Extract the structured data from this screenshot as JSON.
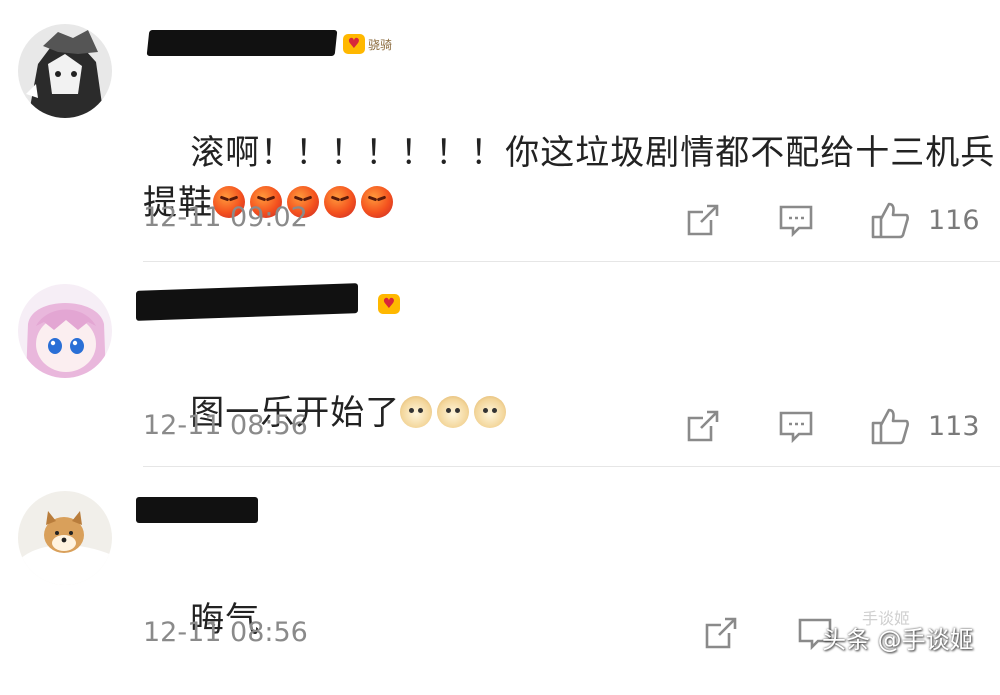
{
  "comments": [
    {
      "badge_label": "骁骑",
      "text_line1": "滚啊！！！！！！！你这垃圾剧情都不配给十三机兵",
      "text_line2": "提鞋",
      "emojis": [
        "angry-emoji",
        "angry-emoji",
        "angry-emoji",
        "angry-emoji",
        "angry-emoji"
      ],
      "time": "12-11 09:02",
      "likes": "116"
    },
    {
      "badge_label": "",
      "text_line1": "图一乐开始了",
      "emojis": [
        "doge-emoji",
        "doge-emoji",
        "doge-emoji"
      ],
      "time": "12-11 08:56",
      "likes": "113"
    },
    {
      "text_line1": "晦气",
      "time": "12-11 08:56",
      "likes": ""
    }
  ],
  "watermark": {
    "text": "头条 @手谈姬",
    "faint": "手谈姬"
  },
  "colors": {
    "text": "#222222",
    "meta": "#8a8a8a",
    "badge": "#ffb800",
    "divider": "#e6e6e6"
  }
}
